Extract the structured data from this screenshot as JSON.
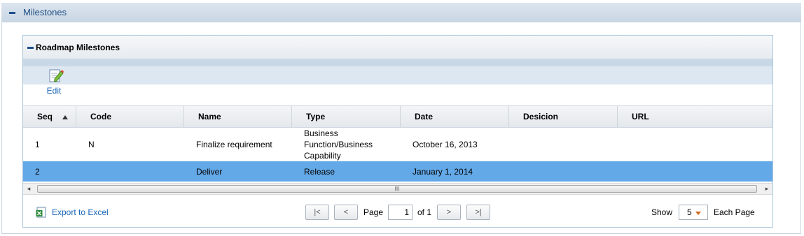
{
  "outer": {
    "title": "Milestones"
  },
  "panel": {
    "title": "Roadmap Milestones"
  },
  "toolbar": {
    "edit_label": "Edit"
  },
  "grid": {
    "columns": [
      "Seq",
      "Code",
      "Name",
      "Type",
      "Date",
      "Desicion",
      "URL"
    ],
    "rows": [
      {
        "seq": "1",
        "code": "N",
        "name": "Finalize requirement",
        "type_lines": [
          "Business",
          "Function/Business",
          "Capability"
        ],
        "date": "October 16, 2013",
        "decision": "",
        "url": ""
      },
      {
        "seq": "2",
        "code": "",
        "name": "Deliver",
        "type": "Release",
        "date": "January 1, 2014",
        "decision": "",
        "url": ""
      }
    ],
    "selected_row_color": "#64a9e7"
  },
  "scrollbar": {
    "thumb_grip": "III"
  },
  "footer": {
    "export_label": "Export to Excel",
    "page_label": "Page",
    "page_value": "1",
    "of_label": "of 1",
    "show_label": "Show",
    "show_value": "5",
    "each_page_label": "Each Page"
  }
}
